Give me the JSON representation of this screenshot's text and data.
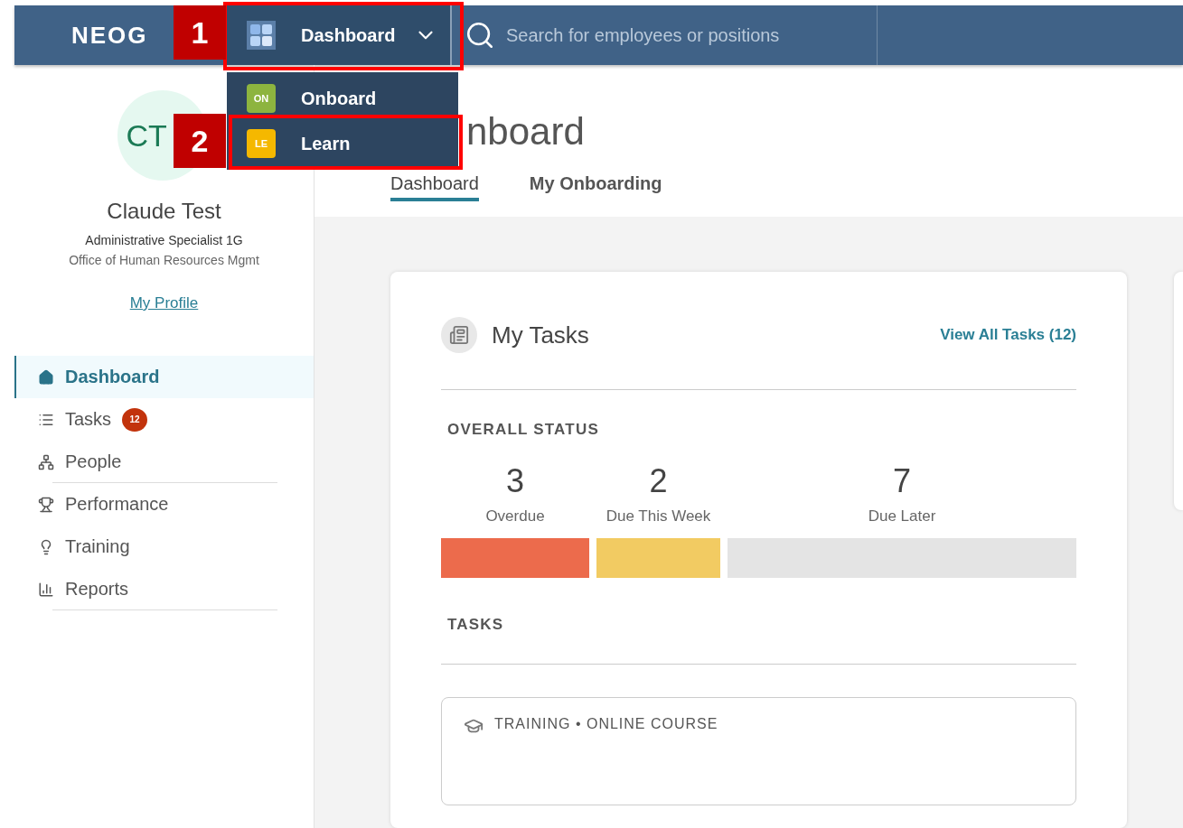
{
  "header": {
    "logo": "NEOG",
    "app_switcher": {
      "label": "Dashboard",
      "expanded": true
    },
    "search": {
      "placeholder": "Search for employees or positions"
    }
  },
  "app_menu": [
    {
      "badge": "ON",
      "label": "Onboard",
      "color": "#8db43f"
    },
    {
      "badge": "LE",
      "label": "Learn",
      "color": "#f5b800"
    }
  ],
  "callouts": [
    {
      "number": "1"
    },
    {
      "number": "2"
    }
  ],
  "profile": {
    "initials": "CT",
    "name": "Claude Test",
    "title": "Administrative Specialist 1G",
    "department": "Office of Human Resources Mgmt",
    "link": "My Profile"
  },
  "nav": [
    {
      "label": "Dashboard",
      "selected": true
    },
    {
      "label": "Tasks",
      "selected": false,
      "count": "12"
    },
    {
      "label": "People",
      "selected": false
    },
    {
      "label": "Performance",
      "selected": false
    },
    {
      "label": "Training",
      "selected": false
    },
    {
      "label": "Reports",
      "selected": false
    }
  ],
  "page": {
    "title": "nboard",
    "tabs": [
      {
        "label": "Dashboard",
        "selected": true
      },
      {
        "label": "My Onboarding",
        "selected": false
      }
    ]
  },
  "tasks_card": {
    "title": "My Tasks",
    "link": "View All Tasks (12)",
    "status_heading": "OVERALL STATUS",
    "status": [
      {
        "count": "3",
        "label": "Overdue",
        "color": "#ec6b4c"
      },
      {
        "count": "2",
        "label": "Due This Week",
        "color": "#f2cb62"
      },
      {
        "count": "7",
        "label": "Due Later",
        "color": "#e4e4e4"
      }
    ],
    "tasks_heading": "TASKS",
    "task": {
      "category": "TRAINING • ONLINE COURSE"
    }
  }
}
